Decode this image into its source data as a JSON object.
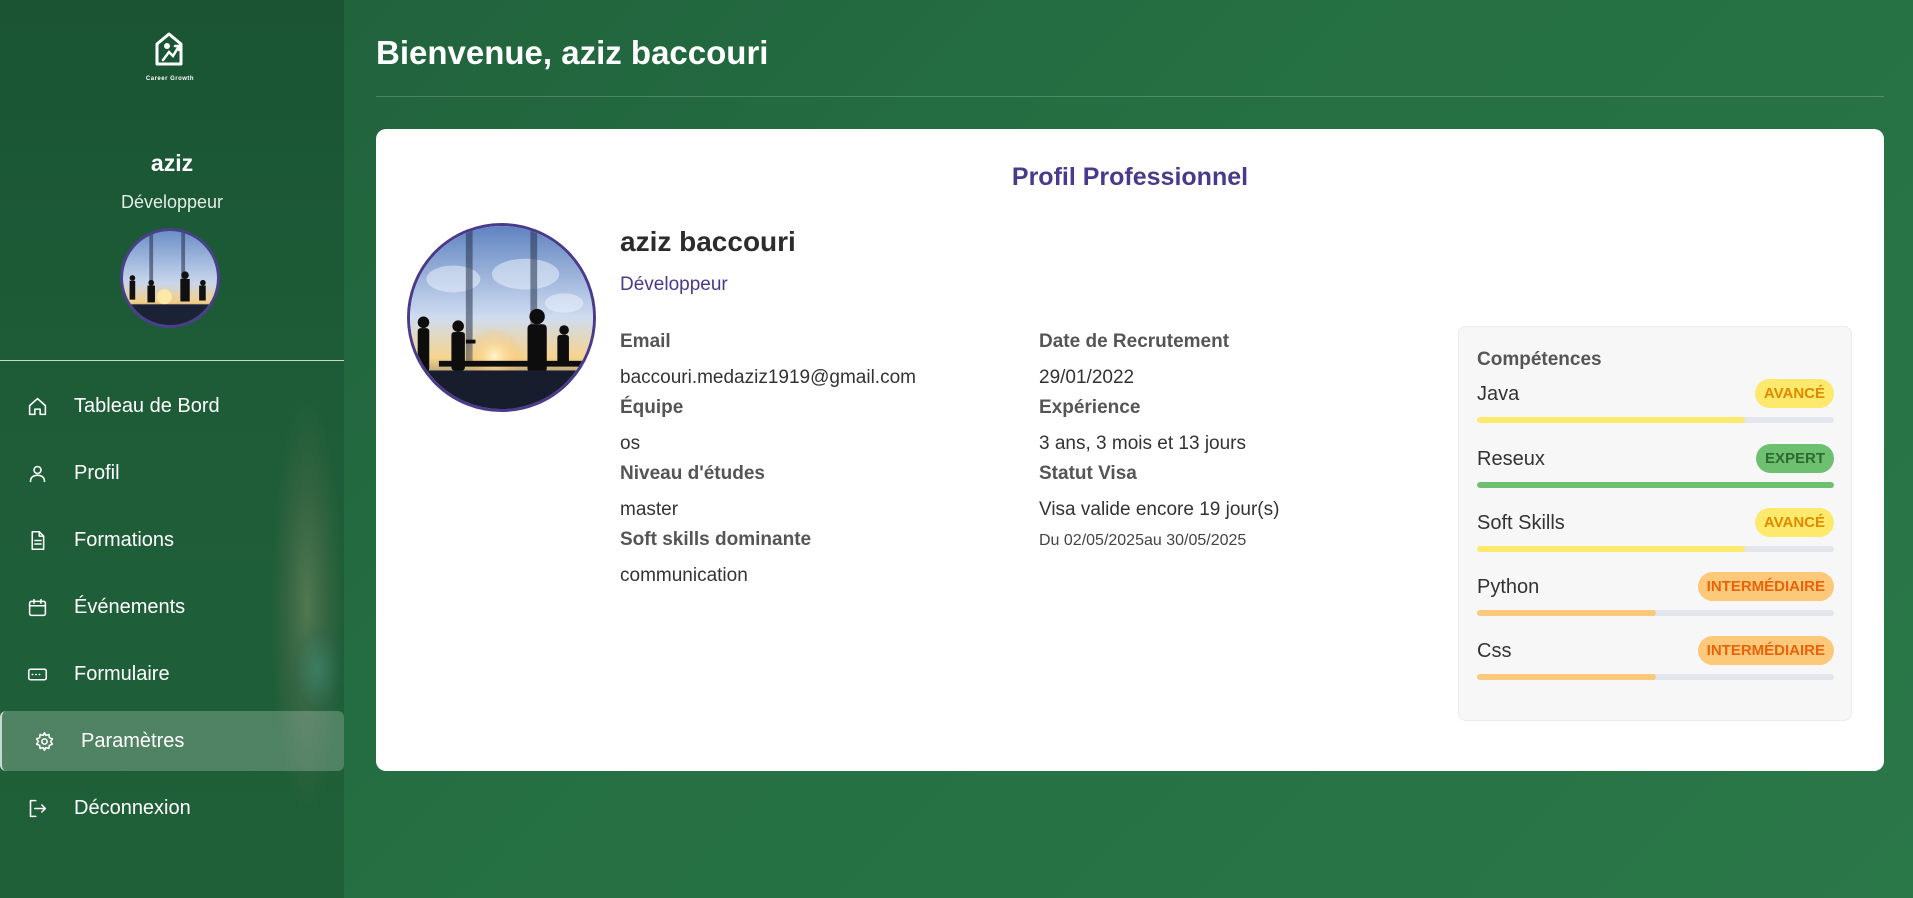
{
  "sidebar": {
    "logo_text": "Career Growth",
    "user_name": "aziz",
    "user_role": "Développeur",
    "nav": [
      {
        "label": "Tableau de Bord",
        "icon": "home-icon"
      },
      {
        "label": "Profil",
        "icon": "user-icon"
      },
      {
        "label": "Formations",
        "icon": "document-icon"
      },
      {
        "label": "Événements",
        "icon": "calendar-icon"
      },
      {
        "label": "Formulaire",
        "icon": "form-icon"
      },
      {
        "label": "Paramètres",
        "icon": "gear-icon"
      },
      {
        "label": "Déconnexion",
        "icon": "logout-icon"
      }
    ],
    "active_item": "Paramètres"
  },
  "header": {
    "welcome": "Bienvenue, aziz baccouri"
  },
  "profile": {
    "title": "Profil Professionnel",
    "full_name": "aziz baccouri",
    "role": "Développeur",
    "fields": {
      "email_label": "Email",
      "email": "baccouri.medaziz1919@gmail.com",
      "team_label": "Équipe",
      "team": "os",
      "education_label": "Niveau d'études",
      "education": "master",
      "softskill_label": "Soft skills dominante",
      "softskill": "communication",
      "hire_date_label": "Date de Recrutement",
      "hire_date": "29/01/2022",
      "experience_label": "Expérience",
      "experience": "3 ans, 3 mois et 13 jours",
      "visa_label": "Statut Visa",
      "visa": "Visa valide encore 19 jour(s)",
      "visa_period": "Du 02/05/2025au 30/05/2025"
    }
  },
  "skills": {
    "title": "Compétences",
    "items": [
      {
        "name": "Java",
        "level": "AVANCÉ",
        "progress": 0.75,
        "color": "#fde96b",
        "badge_bg": "#fde96b",
        "badge_fg": "#e08a00"
      },
      {
        "name": "Reseux",
        "level": "EXPERT",
        "progress": 1.0,
        "color": "#6cc070",
        "badge_bg": "#6cc070",
        "badge_fg": "#2e6a2f"
      },
      {
        "name": "Soft Skills",
        "level": "AVANCÉ",
        "progress": 0.75,
        "color": "#fde96b",
        "badge_bg": "#fde96b",
        "badge_fg": "#e08a00"
      },
      {
        "name": "Python",
        "level": "INTERMÉDIAIRE",
        "progress": 0.5,
        "color": "#fcc97a",
        "badge_bg": "#fcc97a",
        "badge_fg": "#e8630a"
      },
      {
        "name": "Css",
        "level": "INTERMÉDIAIRE",
        "progress": 0.5,
        "color": "#fcc97a",
        "badge_bg": "#fcc97a",
        "badge_fg": "#e8630a"
      }
    ]
  }
}
